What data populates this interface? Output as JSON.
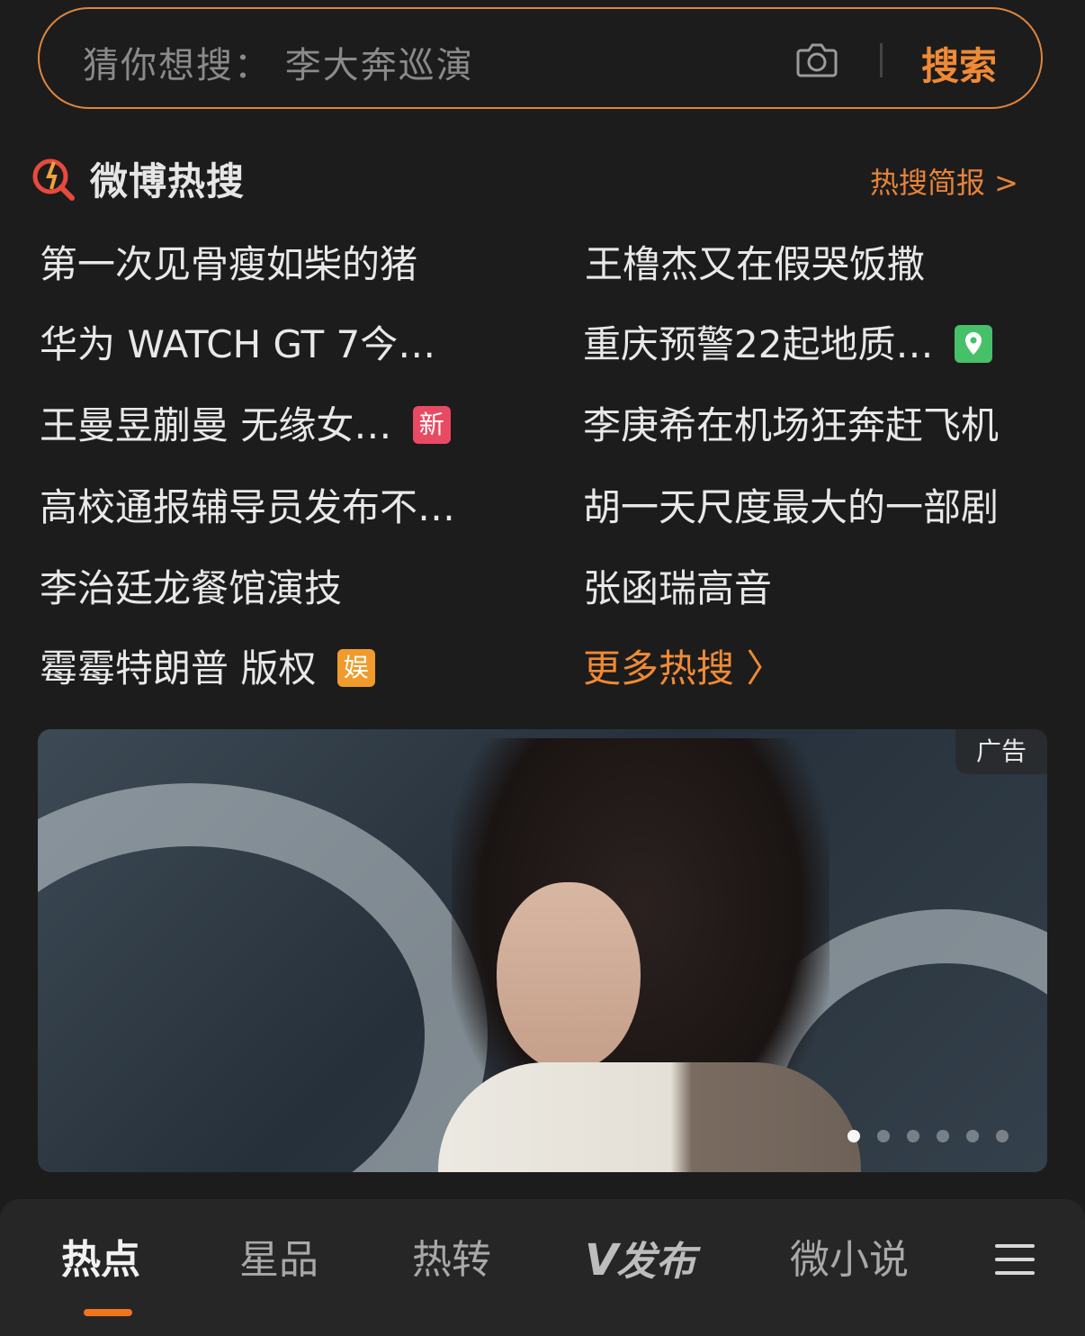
{
  "search": {
    "placeholder": "猜你想搜：  李大奔巡演",
    "button_label": "搜索"
  },
  "hot_section": {
    "title": "微博热搜",
    "brief_link": "热搜简报 >",
    "items": [
      {
        "text": "第一次见骨瘦如柴的猪",
        "badge": ""
      },
      {
        "text": "王橹杰又在假哭饭撒",
        "badge": ""
      },
      {
        "text": "华为 WATCH GT 7今…",
        "badge": ""
      },
      {
        "text": "重庆预警22起地质…",
        "badge": "location"
      },
      {
        "text": "王曼昱蒯曼 无缘女…",
        "badge": "新"
      },
      {
        "text": "李庚希在机场狂奔赶飞机",
        "badge": ""
      },
      {
        "text": "高校通报辅导员发布不…",
        "badge": ""
      },
      {
        "text": "胡一天尺度最大的一部剧",
        "badge": ""
      },
      {
        "text": "李治廷龙餐馆演技",
        "badge": ""
      },
      {
        "text": "张函瑞高音",
        "badge": ""
      },
      {
        "text": "霉霉特朗普 版权",
        "badge": "娱"
      }
    ],
    "more_label": "更多热搜",
    "more_arrow": "〉"
  },
  "ad_banner": {
    "tag": "广告",
    "carousel_count": 6,
    "carousel_active": 0
  },
  "tabs": [
    {
      "label": "热点",
      "active": true
    },
    {
      "label": "星品",
      "active": false
    },
    {
      "label": "热转",
      "active": false
    },
    {
      "label": "发布",
      "active": false
    },
    {
      "label": "微小说",
      "active": false
    }
  ],
  "colors": {
    "accent": "#f08a35",
    "background": "#1c1c1c",
    "badge_new": "#e84a63",
    "badge_ent": "#f09b2b",
    "badge_location": "#47c06a"
  },
  "icons": {
    "camera": "camera-icon",
    "hot_logo": "weibo-hot-search-icon",
    "location": "location-pin-icon",
    "menu": "menu-icon"
  }
}
